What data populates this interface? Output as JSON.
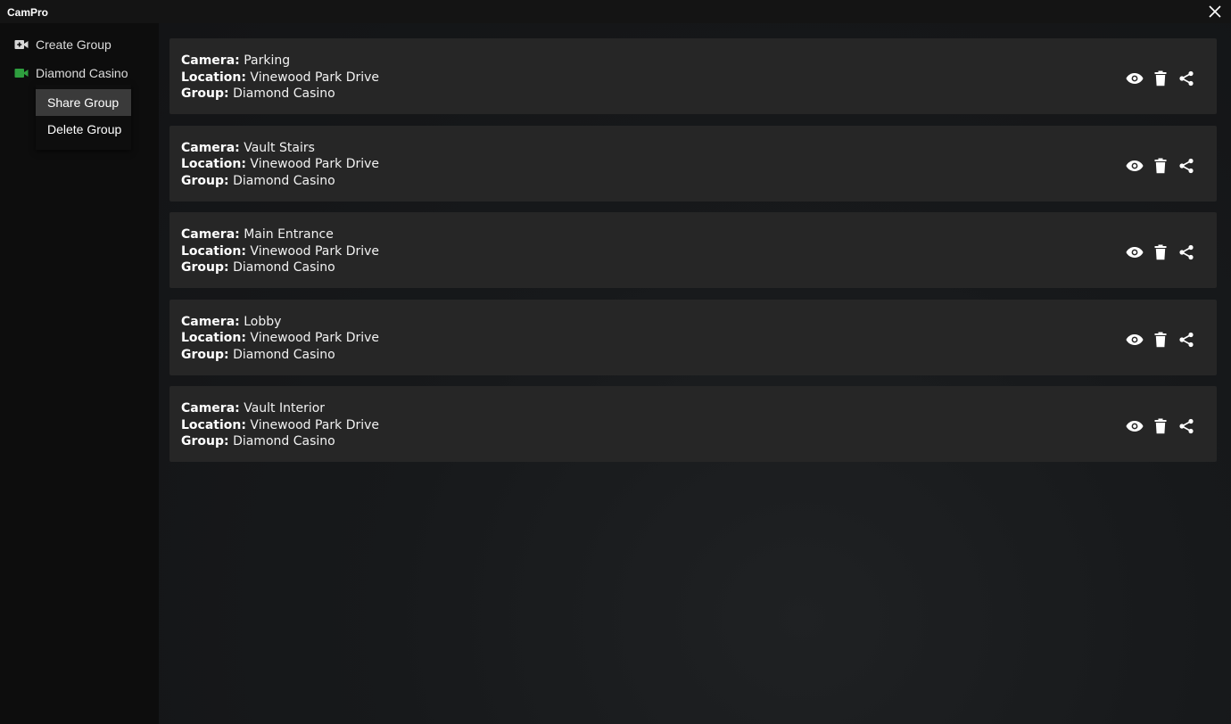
{
  "app": {
    "title": "CamPro"
  },
  "sidebar": {
    "items": [
      {
        "label": "Create Group",
        "icon": "add-video-icon"
      },
      {
        "label": "Diamond Casino",
        "icon": "video-camera-icon",
        "icon_color": "#2e9e3e"
      }
    ],
    "context_menu": {
      "items": [
        {
          "label": "Share Group"
        },
        {
          "label": "Delete Group"
        }
      ]
    }
  },
  "labels": {
    "camera": "Camera:",
    "location": "Location:",
    "group": "Group:"
  },
  "cameras": [
    {
      "camera": "Parking",
      "location": "Vinewood Park Drive",
      "group": "Diamond Casino"
    },
    {
      "camera": "Vault Stairs",
      "location": "Vinewood Park Drive",
      "group": "Diamond Casino"
    },
    {
      "camera": "Main Entrance",
      "location": "Vinewood Park Drive",
      "group": "Diamond Casino"
    },
    {
      "camera": "Lobby",
      "location": "Vinewood Park Drive",
      "group": "Diamond Casino"
    },
    {
      "camera": "Vault Interior",
      "location": "Vinewood Park Drive",
      "group": "Diamond Casino"
    }
  ],
  "actions": [
    "eye-icon",
    "trash-icon",
    "share-icon"
  ],
  "colors": {
    "accent_green": "#2e9e3e",
    "card_bg": "#262626",
    "sidebar_bg": "#0d0d0d"
  }
}
